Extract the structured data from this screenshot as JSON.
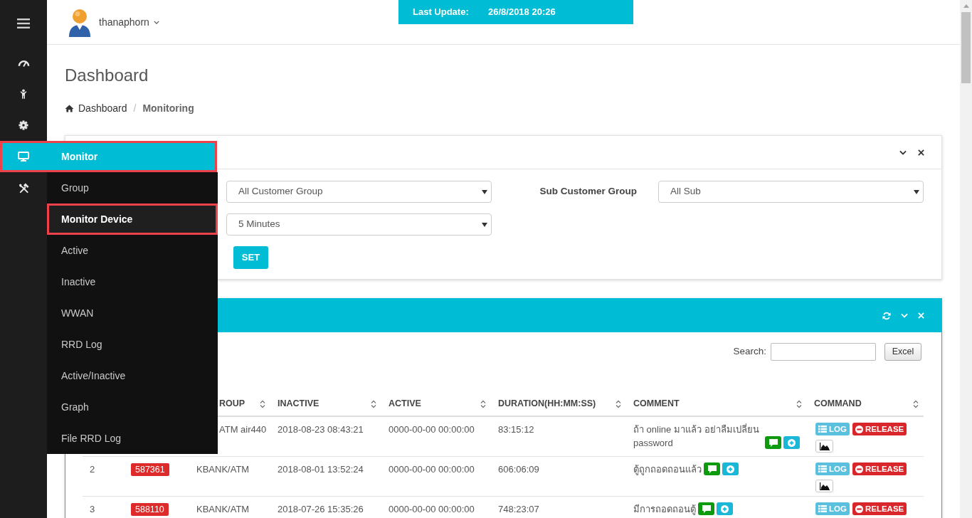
{
  "sidebar": {
    "items": [
      {
        "selected": false,
        "outlined": false
      },
      {
        "selected": false,
        "outlined": false
      },
      {
        "selected": false,
        "outlined": false
      },
      {
        "selected": true,
        "outlined": true,
        "label": "Monitor",
        "submenu": [
          {
            "label": "Group",
            "selected": false,
            "outlined": false
          },
          {
            "label": "Monitor Device",
            "selected": true,
            "outlined": true
          },
          {
            "label": "Active",
            "selected": false,
            "outlined": false
          },
          {
            "label": "Inactive",
            "selected": false,
            "outlined": false
          },
          {
            "label": "WWAN",
            "selected": false,
            "outlined": false
          },
          {
            "label": "RRD Log",
            "selected": false,
            "outlined": false
          },
          {
            "label": "Active/Inactive",
            "selected": false,
            "outlined": false
          },
          {
            "label": "Graph",
            "selected": false,
            "outlined": false
          },
          {
            "label": "File RRD Log",
            "selected": false,
            "outlined": false
          }
        ]
      },
      {
        "selected": false,
        "outlined": false
      }
    ]
  },
  "header": {
    "user_name": "thanaphorn",
    "last_update": {
      "label": "Last Update:",
      "value": "26/8/2018 20:26"
    }
  },
  "page": {
    "title": "Dashboard",
    "breadcrumb": {
      "separator": "/",
      "items": [
        {
          "label": "Dashboard",
          "current": false
        },
        {
          "label": "Monitoring",
          "current": true
        }
      ]
    }
  },
  "filter_panel": {
    "rows": [
      [
        {
          "value": "All Customer Group"
        },
        {
          "label": "Sub Customer Group",
          "value": "All Sub"
        }
      ],
      [
        {
          "value": "5 Minutes"
        }
      ]
    ],
    "button": "SET"
  },
  "table_panel": {
    "search": {
      "label": "Search:"
    },
    "export_button": "Excel",
    "columns": [
      {
        "label": "ROUP",
        "sortable": true
      },
      {
        "label": "INACTIVE",
        "sortable": true
      },
      {
        "label": "ACTIVE",
        "sortable": true
      },
      {
        "label": "DURATION(HH:MM:SS)",
        "sortable": true
      },
      {
        "label": "COMMENT",
        "sortable": true
      },
      {
        "label": "COMMAND",
        "sortable": true
      }
    ],
    "rows": [
      {
        "group": "ATM air440",
        "inactive": "2018-08-23 08:43:21",
        "active": "0000-00-00 00:00:00",
        "duration": "83:15:12",
        "comment": "ถ้า online มาแล้ว อย่าลืมเปลี่ยน password",
        "commands": [
          {
            "kind": "log",
            "label": "LOG"
          },
          {
            "kind": "release",
            "label": "RELEASE"
          },
          {
            "kind": "graph"
          }
        ]
      },
      {
        "number": "2",
        "id": "587361",
        "group": "KBANK/ATM",
        "inactive": "2018-08-01 13:52:24",
        "active": "0000-00-00 00:00:00",
        "duration": "606:06:09",
        "comment": "ตู้ถูกถอดถอนแล้ว",
        "commands": [
          {
            "kind": "log",
            "label": "LOG"
          },
          {
            "kind": "release",
            "label": "RELEASE"
          },
          {
            "kind": "graph"
          }
        ]
      },
      {
        "number": "3",
        "id": "588110",
        "group": "KBANK/ATM",
        "inactive": "2018-07-26 15:35:26",
        "active": "0000-00-00 00:00:00",
        "duration": "748:23:07",
        "comment": "มีการถอดถอนตู้",
        "commands": [
          {
            "kind": "log",
            "label": "LOG"
          },
          {
            "kind": "release",
            "label": "RELEASE"
          }
        ]
      }
    ]
  }
}
